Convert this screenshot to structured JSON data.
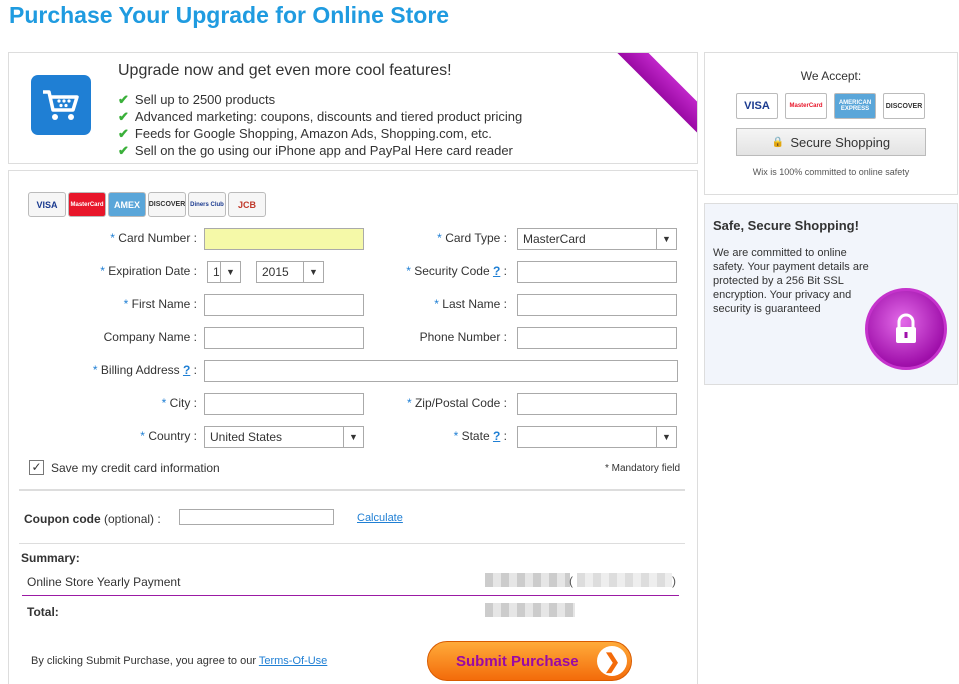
{
  "page_title": "Purchase Your Upgrade for Online Store",
  "banner": {
    "headline": "Upgrade now and get even more cool features!",
    "features": [
      "Sell up to 2500 products",
      "Advanced marketing: coupons, discounts and tiered product pricing",
      "Feeds for Google Shopping, Amazon Ads, Shopping.com, etc.",
      "Sell on the go using our iPhone app and PayPal Here card reader"
    ]
  },
  "form": {
    "cards": [
      "VISA",
      "MasterCard",
      "AMEX",
      "DISCOVER",
      "Diners Club",
      "JCB"
    ],
    "card_number_label": "Card Number :",
    "card_type_label": "Card Type :",
    "card_type_value": "MasterCard",
    "expiration_label": "Expiration Date :",
    "exp_month": "1",
    "exp_year": "2015",
    "security_label": "Security Code",
    "first_name_label": "First Name :",
    "last_name_label": "Last Name :",
    "company_label": "Company Name :",
    "phone_label": "Phone Number :",
    "billing_label": "Billing Address",
    "city_label": "City :",
    "zip_label": "Zip/Postal Code :",
    "country_label": "Country :",
    "country_value": "United States",
    "state_label": "State",
    "question": "?",
    "colon": ":",
    "required": "*",
    "save_label": "Save my credit card information",
    "mandatory": "* Mandatory field",
    "coupon_label_bold": "Coupon code",
    "coupon_label_rest": " (optional) :",
    "calculate": "Calculate",
    "summary": "Summary:",
    "line_item": "Online Store Yearly Payment",
    "paren_open": "(",
    "paren_close": ")",
    "total": "Total:",
    "agree_text": "By clicking Submit Purchase, you agree to our ",
    "terms": "Terms-Of-Use",
    "submit": "Submit Purchase"
  },
  "accept": {
    "title": "We Accept:",
    "cards": [
      "VISA",
      "MasterCard",
      "AMERICAN EXPRESS",
      "DISCOVER"
    ],
    "secure_button": "Secure Shopping",
    "note": "Wix is 100% committed to online safety"
  },
  "safe": {
    "title": "Safe, Secure Shopping!",
    "text": "We are committed to online safety. Your payment details are protected by a 256 Bit SSL encryption. Your privacy and security is guaranteed"
  },
  "colors": {
    "title_blue": "#1f9be0",
    "purple": "#9a0aa4",
    "orange": "#f36b0a",
    "check_green": "#3ab03a"
  }
}
